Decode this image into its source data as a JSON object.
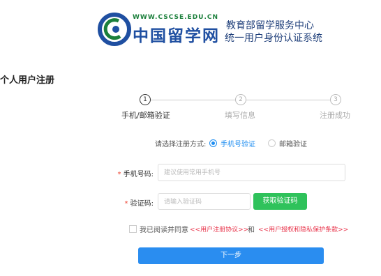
{
  "header": {
    "logo_url": "WWW.CSCSE.EDU.CN",
    "logo_cn": "中国留学网",
    "system_line1": "教育部留学服务中心",
    "system_line2": "统一用户身份认证系统"
  },
  "page_title": "个人用户注册",
  "steps": [
    {
      "number": "1",
      "label": "手机/邮箱验证",
      "active": true
    },
    {
      "number": "2",
      "label": "填写信息",
      "active": false
    },
    {
      "number": "3",
      "label": "注册成功",
      "active": false
    }
  ],
  "method": {
    "label": "请选择注册方式:",
    "options": [
      {
        "label": "手机号验证",
        "selected": true
      },
      {
        "label": "邮箱验证",
        "selected": false
      }
    ]
  },
  "form": {
    "required_mark": "*",
    "phone_label": "手机号码:",
    "phone_placeholder": "建议使用常用手机号",
    "code_label": "验证码:",
    "code_placeholder": "请输入验证码",
    "get_code_button": "获取验证码"
  },
  "agreement": {
    "text": "我已阅读并同意",
    "link1": "<<用户注册协议>>",
    "and": "和",
    "link2": "<<用户授权和隐私保护条款>>"
  },
  "next_button": "下一步",
  "colors": {
    "primary_blue": "#2a8df0",
    "green_button": "#2fc25b",
    "link_red": "#e8334a",
    "brand_blue": "#1f4fa1",
    "brand_green": "#1b7f3b"
  }
}
